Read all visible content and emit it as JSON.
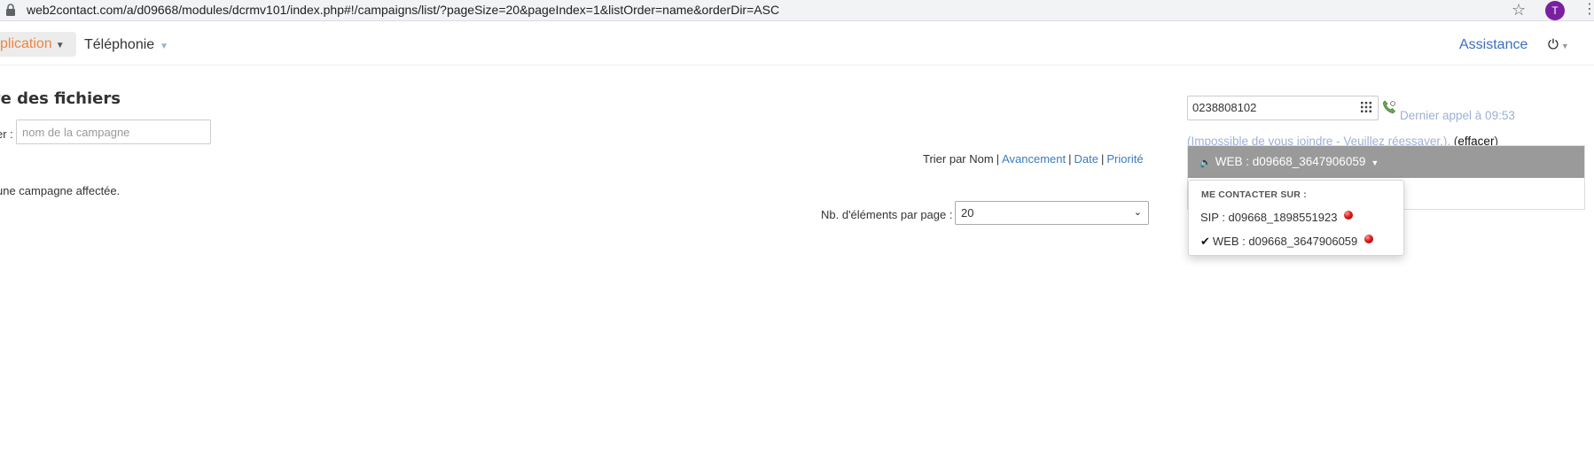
{
  "browser": {
    "url": "web2contact.com/a/d09668/modules/dcrmv101/index.php#!/campaigns/list/?pageSize=20&pageIndex=1&listOrder=name&orderDir=ASC",
    "avatar_letter": "T",
    "icons": [
      "lock-icon",
      "star-icon",
      "kebab-menu-icon"
    ]
  },
  "nav": {
    "application_label": "plication",
    "telephonie_label": "Téléphonie",
    "assistance_label": "Assistance",
    "accent_color": "#f0843e",
    "link_color": "#3b6fc0"
  },
  "main": {
    "title": "te des fichiers",
    "filter_label": "er :",
    "filter_placeholder": "nom de la campagne",
    "empty_message": "une campagne affectée.",
    "sort": {
      "prefix": "Trier par Nom",
      "separator": "|",
      "options": [
        "Avancement",
        "Date",
        "Priorité"
      ]
    },
    "page_size": {
      "label": "Nb. d'éléments par page :",
      "value": "20"
    }
  },
  "phone": {
    "number": "0238808102",
    "last_call_text": "Dernier appel à 09:53 (Impossible de vous joindre - Veuillez réessayer.).",
    "erase_open": "(",
    "erase_label": "effacer",
    "erase_close": ")",
    "line": {
      "current": "WEB : d09668_3647906059",
      "menu_header": "ME CONTACTER SUR :",
      "options": [
        {
          "label": "SIP : d09668_1898551923",
          "selected": false,
          "status": "red"
        },
        {
          "label": "WEB : d09668_3647906059",
          "selected": true,
          "status": "red"
        }
      ]
    }
  }
}
